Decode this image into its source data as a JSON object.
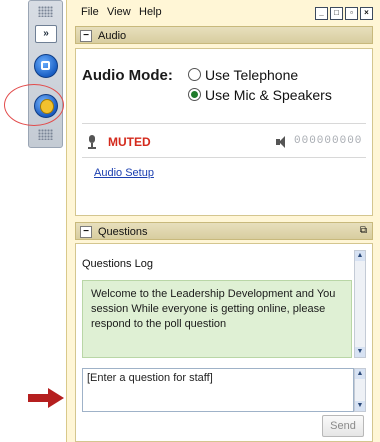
{
  "menu": {
    "file": "File",
    "view": "View",
    "help": "Help"
  },
  "dock": {
    "expand_label": "»"
  },
  "audio": {
    "section_title": "Audio",
    "mode_label": "Audio Mode:",
    "option_telephone": "Use Telephone",
    "option_mic": "Use Mic & Speakers",
    "selected": "Use Mic & Speakers",
    "mic_status": "MUTED",
    "speaker_level": "000000000",
    "setup_link": "Audio Setup"
  },
  "questions": {
    "section_title": "Questions",
    "log_title": "Questions Log",
    "log_text": "Welcome to the Leadership Development and You session While everyone is getting online, please respond to the poll question",
    "input_value": "[Enter a question for staff]",
    "send_label": "Send"
  },
  "colors": {
    "panel_bg": "#fff6d6",
    "muted": "#d42a1c",
    "log_bg": "#dff0d4",
    "annotation": "#b51f1f"
  }
}
